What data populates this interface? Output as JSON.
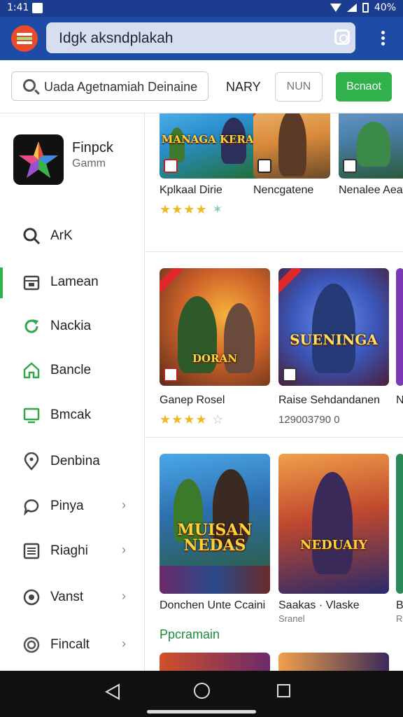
{
  "status": {
    "time": "1:41",
    "battery": "40%"
  },
  "appbar": {
    "search_text": "Idgk aksndplakah"
  },
  "subbar": {
    "search_text": "Uada Agetnamiah Deinaine",
    "nav_label": "NARY",
    "outline_button": "NUN",
    "green_button": "Bcnaot"
  },
  "sidebar": {
    "brand_name": "Finpck",
    "brand_sub": "Gamm",
    "items": [
      {
        "label": "ArK",
        "icon": "search-icon"
      },
      {
        "label": "Lamean",
        "icon": "calendar-icon"
      },
      {
        "label": "Nackia",
        "icon": "refresh-icon"
      },
      {
        "label": "Bancle",
        "icon": "home-icon"
      },
      {
        "label": "Bmcak",
        "icon": "monitor-icon"
      },
      {
        "label": "Denbina",
        "icon": "location-icon"
      },
      {
        "label": "Pinya",
        "icon": "chat-icon"
      },
      {
        "label": "Riaghi",
        "icon": "list-icon"
      },
      {
        "label": "Vanst",
        "icon": "globe-icon"
      },
      {
        "label": "Fincalt",
        "icon": "settings-icon"
      }
    ],
    "chevron": "›"
  },
  "content": {
    "row1": [
      {
        "title": "Kplkaal Dirie",
        "art_title": "MANAGA KERAIN",
        "rating": 4,
        "color": "#2b8fd0"
      },
      {
        "title": "Nencgatene",
        "art_title": "",
        "rating": 0,
        "color": "#d98a3a"
      },
      {
        "title": "Nenalee Aeafr",
        "art_title": "",
        "rating": 0,
        "color": "#4a7ea8"
      }
    ],
    "row2": [
      {
        "title": "Ganep Rosel",
        "art_title": "DORAN",
        "rating": 4,
        "color": "#b8422a"
      },
      {
        "title": "Raise Sehdandanen",
        "art_title": "SUENINGA",
        "meta": "129003790 0",
        "color": "#3a56b8"
      },
      {
        "title": "N",
        "art_title": "",
        "color": "#7a3ab8"
      }
    ],
    "row3": [
      {
        "title": "Donchen Unte Ccaini",
        "art_title": "MUISAN NEDAS",
        "color": "#2e6fb0"
      },
      {
        "title": "Saakas · Vlaske",
        "sub": "Sranel",
        "art_title": "NEDUAIY",
        "color": "#c0482e"
      },
      {
        "title": "B",
        "sub": "R",
        "color": "#2e8a5a"
      }
    ],
    "section_label": "Ppcramain"
  }
}
